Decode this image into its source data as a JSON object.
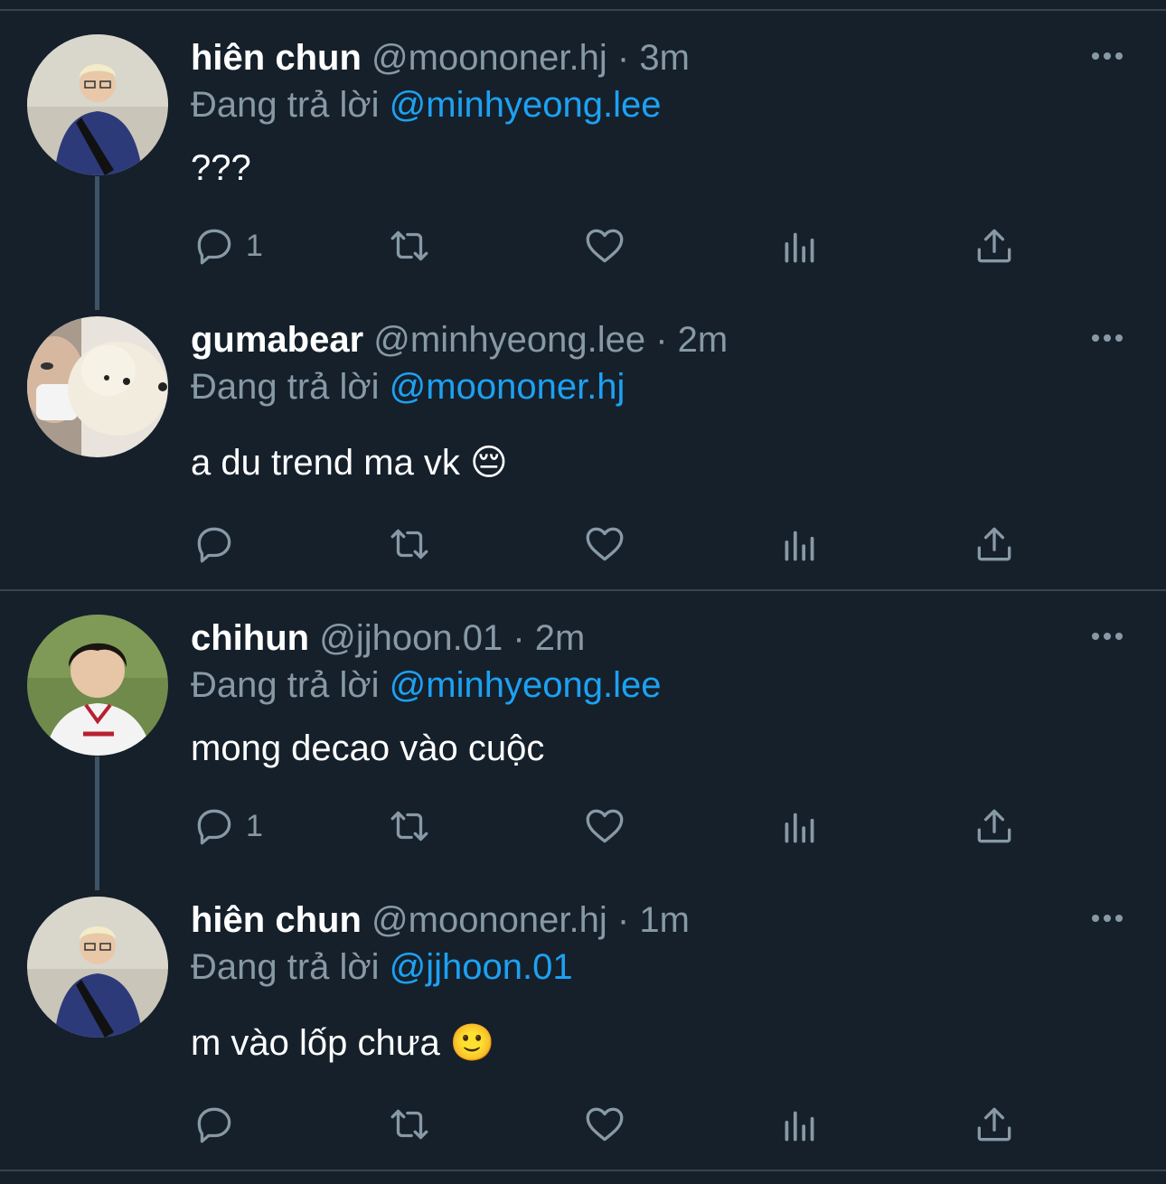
{
  "tweets": [
    {
      "name": "hiên chun",
      "handle": "@moononer.hj",
      "sep": "·",
      "time": "3m",
      "reply_prefix": "Đang trả lời",
      "reply_to": "@minhyeong.lee",
      "text": "???",
      "reply_count": "1"
    },
    {
      "name": "gumabear",
      "handle": "@minhyeong.lee",
      "sep": "·",
      "time": "2m",
      "reply_prefix": "Đang trả lời",
      "reply_to": "@moononer.hj",
      "text": "a du trend ma vk 😔",
      "reply_count": ""
    },
    {
      "name": "chihun",
      "handle": "@jjhoon.01",
      "sep": "·",
      "time": "2m",
      "reply_prefix": "Đang trả lời",
      "reply_to": "@minhyeong.lee",
      "text": "mong decao vào cuộc",
      "reply_count": "1"
    },
    {
      "name": "hiên chun",
      "handle": "@moononer.hj",
      "sep": "·",
      "time": "1m",
      "reply_prefix": "Đang trả lời",
      "reply_to": "@jjhoon.01",
      "text": "m vào lốp chưa 🙂",
      "reply_count": ""
    }
  ],
  "colors": {
    "background": "#15202b",
    "divider": "#38444d",
    "muted": "#8899a6",
    "link": "#1da1f2",
    "thread_line": "#3d5466"
  },
  "icons": [
    "reply-icon",
    "retweet-icon",
    "like-icon",
    "analytics-icon",
    "share-icon",
    "more-icon"
  ]
}
